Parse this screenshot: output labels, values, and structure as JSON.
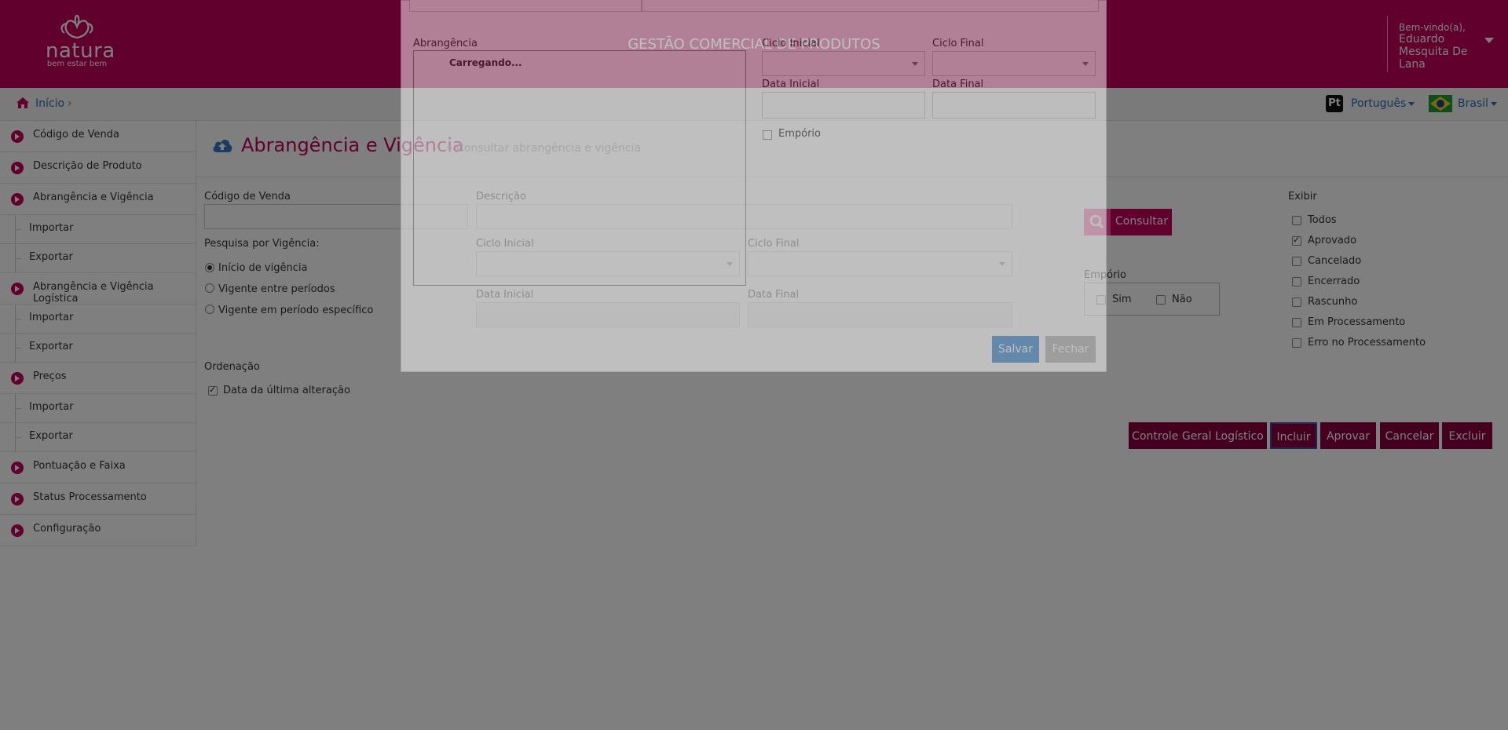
{
  "header": {
    "logo_brand": "natura",
    "logo_tagline": "bem estar bem",
    "app_title": "GESTÃO COMERCIAL DE PRODUTOS",
    "user_greeting": "Bem-vindo(a),",
    "user_name": "Eduardo Mesquita De Lana"
  },
  "breadcrumb": {
    "home_label": "Início",
    "separator": "›"
  },
  "locale": {
    "language_badge": "Pt",
    "language": "Português",
    "country": "Brasil"
  },
  "sidebar": {
    "items": [
      {
        "label": "Código de Venda"
      },
      {
        "label": "Descrição de Produto"
      },
      {
        "label": "Abrangência e Vigência"
      },
      {
        "label": "Importar"
      },
      {
        "label": "Exportar"
      },
      {
        "label": "Abrangência e Vigência Logística"
      },
      {
        "label": "Importar"
      },
      {
        "label": "Exportar"
      },
      {
        "label": "Preços"
      },
      {
        "label": "Importar"
      },
      {
        "label": "Exportar"
      },
      {
        "label": "Pontuação e Faixa"
      },
      {
        "label": "Status Processamento"
      },
      {
        "label": "Configuração"
      }
    ]
  },
  "page": {
    "title": "Abrangência e Vigência",
    "crumb": "» Consultar abrangência e vigência"
  },
  "form": {
    "codigo_label": "Código de Venda",
    "descricao_label": "Descrição",
    "pesquisa_label": "Pesquisa por Vigência:",
    "radios": [
      {
        "label": "Início de vigência",
        "checked": true
      },
      {
        "label": "Vigente entre períodos",
        "checked": false
      },
      {
        "label": "Vigente em período específico",
        "checked": false
      }
    ],
    "ciclo_inicial_label": "Ciclo Inicial",
    "ciclo_final_label": "Ciclo Final",
    "data_inicial_label": "Data Inicial",
    "data_final_label": "Data Final",
    "ordenacao_label": "Ordenação",
    "ordenacao_option": "Data da última alteração",
    "consultar_label": "Consultar",
    "emporio_label": "Empório",
    "emporio_sim": "Sim",
    "emporio_nao": "Não",
    "exibir_label": "Exibir",
    "exibir_options": [
      {
        "label": "Todos",
        "checked": false
      },
      {
        "label": "Aprovado",
        "checked": true
      },
      {
        "label": "Cancelado",
        "checked": false
      },
      {
        "label": "Encerrado",
        "checked": false
      },
      {
        "label": "Rascunho",
        "checked": false
      },
      {
        "label": "Em Processamento",
        "checked": false
      },
      {
        "label": "Erro no Processamento",
        "checked": false
      }
    ]
  },
  "actions": {
    "controle": "Controle Geral Logístico",
    "incluir": "Incluir",
    "aprovar": "Aprovar",
    "cancelar": "Cancelar",
    "excluir": "Excluir"
  },
  "modal": {
    "abrangencia_label": "Abrangência",
    "loading_text": "Carregando...",
    "ciclo_inicial_label": "Ciclo Inicial",
    "ciclo_final_label": "Ciclo Final",
    "data_inicial_label": "Data Inicial",
    "data_final_label": "Data Final",
    "emporio_label": "Empório",
    "save_label": "Salvar",
    "close_label": "Fechar"
  },
  "colors": {
    "brand": "#c4005b",
    "dark_brand": "#8a0040",
    "link": "#2b6cb0"
  }
}
